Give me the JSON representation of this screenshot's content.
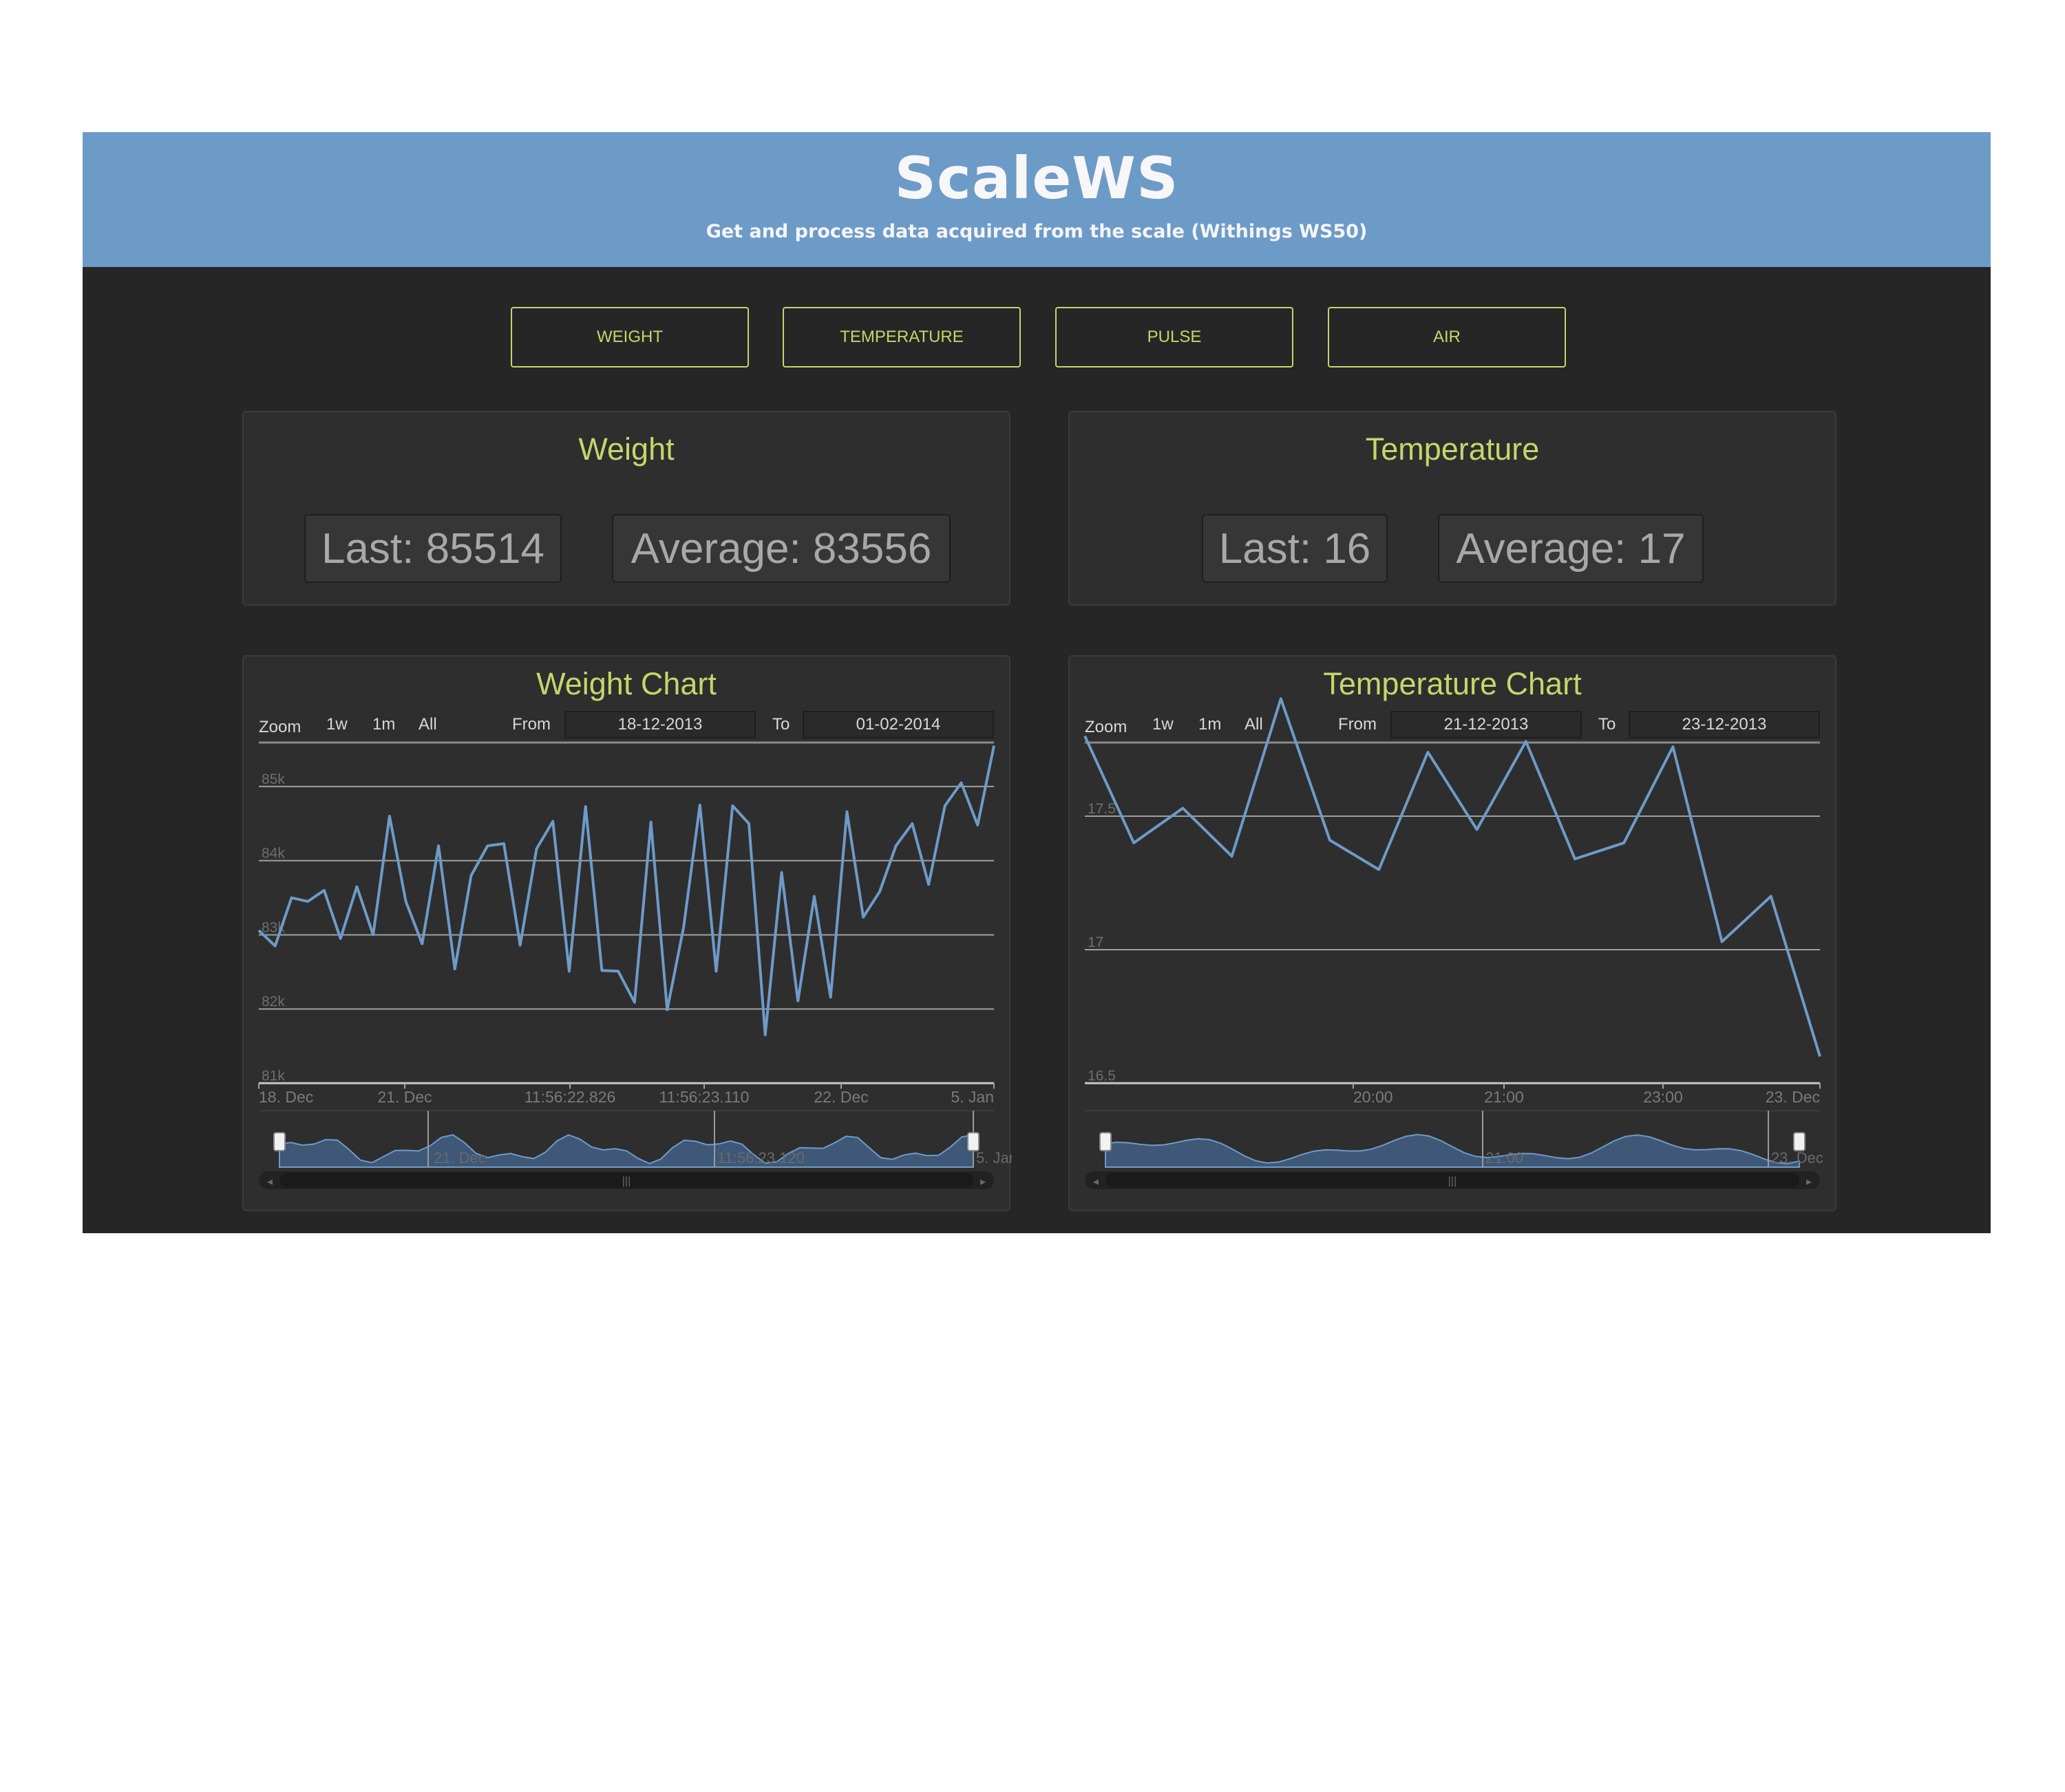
{
  "header": {
    "title": "ScaleWS",
    "subtitle": "Get and process data acquired from the scale (Withings WS50)"
  },
  "nav": {
    "weight": "WEIGHT",
    "temperature": "TEMPERATURE",
    "pulse": "PULSE",
    "air": "AIR"
  },
  "panels": {
    "weight": {
      "title": "Weight",
      "last": "Last: 85514",
      "average": "Average: 83556"
    },
    "temperature": {
      "title": "Temperature",
      "last": "Last: 16",
      "average": "Average: 17"
    }
  },
  "colors": {
    "accent": "#c4d66a",
    "banner": "#6d9bc8",
    "background": "#262626",
    "series": "#6d9bc8"
  },
  "charts": {
    "weight": {
      "title": "Weight Chart",
      "zoom_label": "Zoom",
      "zoom_options": [
        "1w",
        "1m",
        "All"
      ],
      "from_label": "From",
      "from_value": "18-12-2013",
      "to_label": "To",
      "to_value": "01-02-2014",
      "navigator_labels": [
        "21. Dec",
        "11:56:23.120",
        "5. Jan"
      ]
    },
    "temperature": {
      "title": "Temperature Chart",
      "zoom_label": "Zoom",
      "zoom_options": [
        "1w",
        "1m",
        "All"
      ],
      "from_label": "From",
      "from_value": "21-12-2013",
      "to_label": "To",
      "to_value": "23-12-2013",
      "navigator_labels": [
        "21:00",
        "23. Dec"
      ]
    }
  },
  "chart_data": [
    {
      "type": "line",
      "y_ticks": [
        "81k",
        "82k",
        "83k",
        "84k",
        "85k"
      ],
      "ylim": [
        81000,
        85500
      ],
      "x_tick_labels": [
        "18. Dec",
        "21. Dec",
        "11:56:22.826",
        "11:56:23.110",
        "22. Dec",
        "5. Jan"
      ],
      "grid": true,
      "values": [
        83060,
        82850,
        83500,
        83450,
        83600,
        82950,
        83650,
        83000,
        84600,
        83450,
        82880,
        84200,
        82540,
        83800,
        84200,
        84230,
        82860,
        84160,
        84530,
        82510,
        84730,
        82520,
        82510,
        82090,
        84520,
        81990,
        83100,
        84750,
        82510,
        84740,
        84500,
        81650,
        83840,
        82110,
        83520,
        82160,
        84660,
        83240,
        83580,
        84200,
        84500,
        83680,
        84740,
        85050,
        84480,
        85550
      ]
    },
    {
      "type": "line",
      "y_ticks": [
        "16.5",
        "17",
        "17.5"
      ],
      "ylim": [
        16.5,
        17.75
      ],
      "x_tick_labels": [
        "20:00",
        "21:00",
        "23:00",
        "23. Dec"
      ],
      "grid": true,
      "values": [
        17.8,
        17.4,
        17.53,
        17.35,
        17.94,
        17.41,
        17.3,
        17.74,
        17.45,
        17.78,
        17.34,
        17.4,
        17.76,
        17.03,
        17.2,
        16.6
      ]
    }
  ]
}
